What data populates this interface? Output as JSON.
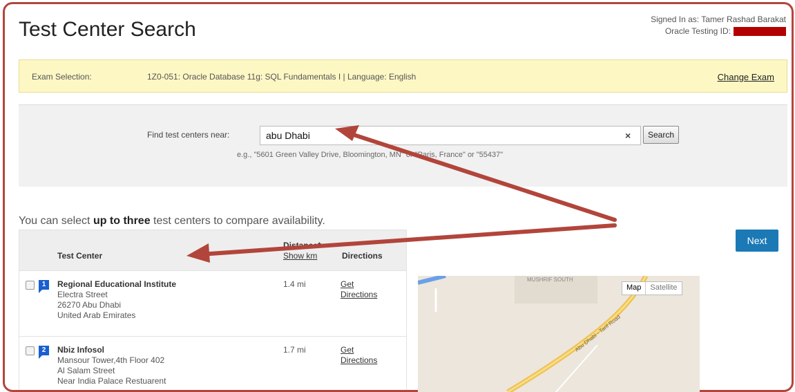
{
  "header": {
    "title": "Test Center Search",
    "signed_in_label": "Signed In as:",
    "signed_in_name": "Tamer Rashad Barakat",
    "testing_id_label": "Oracle Testing ID:"
  },
  "exam": {
    "label": "Exam Selection:",
    "value": "1Z0-051: Oracle Database 11g: SQL Fundamentals I | Language: English",
    "change_label": "Change Exam"
  },
  "search": {
    "label": "Find test centers near:",
    "value": "abu Dhabi",
    "button_label": "Search",
    "clear_symbol": "×",
    "example": "e.g., \"5601 Green Valley Drive, Bloomington, MN\" or \"Paris, France\" or \"55437\""
  },
  "selection": {
    "prefix": "You can select ",
    "bold": "up to three",
    "suffix": " test centers to compare availability."
  },
  "next_label": "Next",
  "table": {
    "col_center": "Test Center",
    "col_distance": "Distance*",
    "col_distance_link": "Show km",
    "col_directions": "Directions",
    "rows": [
      {
        "num": "1",
        "name": "Regional Educational Institute",
        "line1": "Electra Street",
        "line2": "26270 Abu Dhabi",
        "line3": "United Arab Emirates",
        "distance": "1.4  mi",
        "directions1": "Get",
        "directions2": "Directions"
      },
      {
        "num": "2",
        "name": "Nbiz Infosol",
        "line1": "Mansour Tower,4th Floor 402",
        "line2": "Al Salam Street",
        "line3": "Near India Palace Restuarent",
        "distance": "1.7  mi",
        "directions1": "Get",
        "directions2": "Directions"
      }
    ]
  },
  "map": {
    "map_label": "Map",
    "satellite_label": "Satellite",
    "area_label": "MUSHRIF SOUTH",
    "road_label": "Abu Dhabi - Tarif Road"
  },
  "colors": {
    "accent": "#1b79b6",
    "exam_bar": "#fdf7c4",
    "annotation": "#b2453b"
  }
}
